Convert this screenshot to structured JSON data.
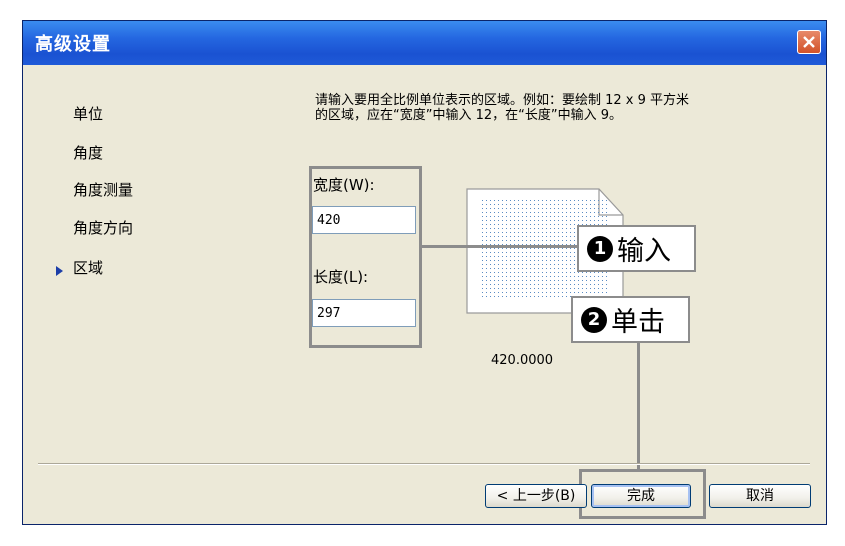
{
  "window": {
    "title": "高级设置",
    "close_icon": "close-icon"
  },
  "nav": {
    "items": [
      {
        "label": "单位"
      },
      {
        "label": "角度"
      },
      {
        "label": "角度测量"
      },
      {
        "label": "角度方向"
      },
      {
        "label": "区域"
      }
    ],
    "selected": "区域",
    "selected_marker_icon": "triangle-right-icon"
  },
  "area": {
    "instruction": "请输入要用全比例单位表示的区域。例如：要绘制 12 x 9 平方米的区域，应在“宽度”中输入 12，在“长度”中输入 9。",
    "width_label": "宽度(W):",
    "width_value": "420",
    "length_label": "长度(L):",
    "length_value": "297",
    "preview_value": "420.0000"
  },
  "callouts": {
    "step1_number": "1",
    "step1_label": "输入",
    "step2_number": "2",
    "step2_label": "单击"
  },
  "buttons": {
    "back_label": "< 上一步(B)",
    "finish_label": "完成",
    "cancel_label": "取消"
  },
  "colors": {
    "title_bar": "#1a52d2",
    "dialog_background": "#ece9d8",
    "annotation_gray": "#8c8c8c",
    "nav_marker": "#1c3ea8"
  }
}
